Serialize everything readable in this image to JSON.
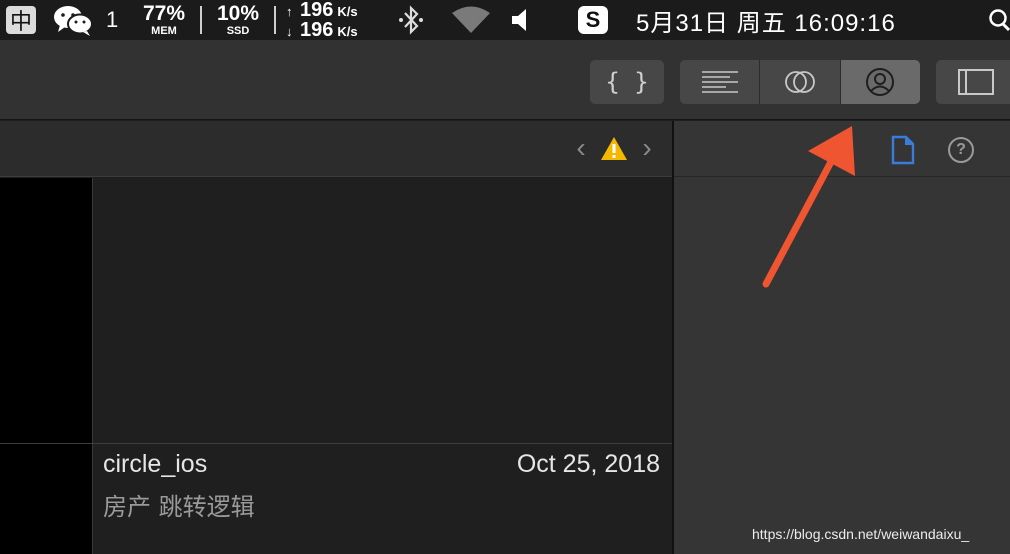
{
  "menubar": {
    "ime_label": "中",
    "wechat_icon": "wechat-icon",
    "wechat_count": "1",
    "mem_value": "77%",
    "mem_label": "MEM",
    "ssd_value": "10%",
    "ssd_label": "SSD",
    "net_up_arrow": "↑",
    "net_up_value": "196",
    "net_up_unit": "K/s",
    "net_down_arrow": "↓",
    "net_down_value": "196",
    "net_down_unit": "K/s",
    "sogou_label": "S",
    "clock": "5月31日 周五  16:09:16"
  },
  "toolbar": {
    "library_label": "{ }",
    "segments": [
      "standard-editor",
      "assistant-editor",
      "version-editor"
    ],
    "active_segment": "version-editor"
  },
  "jumpbar": {
    "prev_label": "‹",
    "next_label": "›",
    "warning_color": "#f5b800"
  },
  "editor": {
    "file_name": "circle_ios",
    "file_date": "Oct 25, 2018",
    "file_desc": "房产 跳转逻辑"
  },
  "inspector": {
    "help_label": "?",
    "file_icon_color": "#3b7cd8"
  },
  "watermark": "https://blog.csdn.net/weiwandaixu_",
  "annotation_color": "#ee5530"
}
